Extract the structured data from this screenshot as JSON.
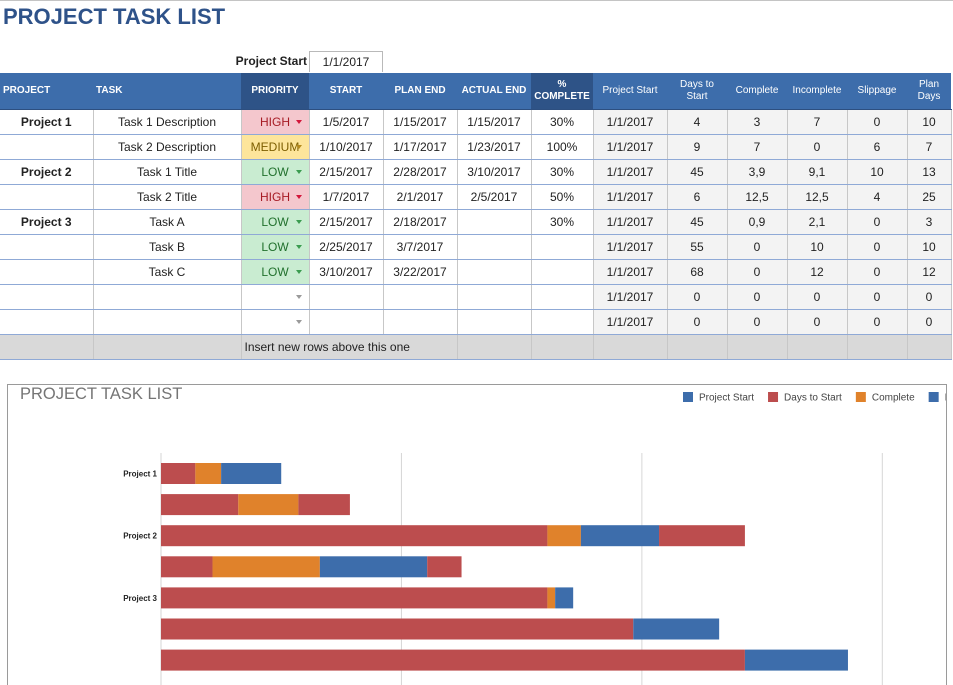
{
  "title": "PROJECT TASK LIST",
  "project_start": {
    "label": "Project Start",
    "value": "1/1/2017"
  },
  "table": {
    "headers": [
      "PROJECT",
      "TASK",
      "PRIORITY",
      "START",
      "PLAN END",
      "ACTUAL END",
      "% COMPLETE",
      "Project Start",
      "Days to Start",
      "Complete",
      "Incomplete",
      "Slippage",
      "Plan Days"
    ],
    "rows": [
      {
        "project": "Project 1",
        "task": "Task 1 Description",
        "priority": "HIGH",
        "start": "1/5/2017",
        "plan_end": "1/15/2017",
        "actual_end": "1/15/2017",
        "percent_complete": "30%",
        "project_start": "1/1/2017",
        "days_to_start": "4",
        "complete": "3",
        "incomplete": "7",
        "slippage": "0",
        "plan_days": "10"
      },
      {
        "project": "",
        "task": "Task 2 Description",
        "priority": "MEDIUM",
        "start": "1/10/2017",
        "plan_end": "1/17/2017",
        "actual_end": "1/23/2017",
        "percent_complete": "100%",
        "project_start": "1/1/2017",
        "days_to_start": "9",
        "complete": "7",
        "incomplete": "0",
        "slippage": "6",
        "plan_days": "7"
      },
      {
        "project": "Project 2",
        "task": "Task 1 Title",
        "priority": "LOW",
        "start": "2/15/2017",
        "plan_end": "2/28/2017",
        "actual_end": "3/10/2017",
        "percent_complete": "30%",
        "project_start": "1/1/2017",
        "days_to_start": "45",
        "complete": "3,9",
        "incomplete": "9,1",
        "slippage": "10",
        "plan_days": "13"
      },
      {
        "project": "",
        "task": "Task 2 Title",
        "priority": "HIGH",
        "start": "1/7/2017",
        "plan_end": "2/1/2017",
        "actual_end": "2/5/2017",
        "percent_complete": "50%",
        "project_start": "1/1/2017",
        "days_to_start": "6",
        "complete": "12,5",
        "incomplete": "12,5",
        "slippage": "4",
        "plan_days": "25"
      },
      {
        "project": "Project 3",
        "task": "Task A",
        "priority": "LOW",
        "start": "2/15/2017",
        "plan_end": "2/18/2017",
        "actual_end": "",
        "percent_complete": "30%",
        "project_start": "1/1/2017",
        "days_to_start": "45",
        "complete": "0,9",
        "incomplete": "2,1",
        "slippage": "0",
        "plan_days": "3"
      },
      {
        "project": "",
        "task": "Task B",
        "priority": "LOW",
        "start": "2/25/2017",
        "plan_end": "3/7/2017",
        "actual_end": "",
        "percent_complete": "",
        "project_start": "1/1/2017",
        "days_to_start": "55",
        "complete": "0",
        "incomplete": "10",
        "slippage": "0",
        "plan_days": "10"
      },
      {
        "project": "",
        "task": "Task C",
        "priority": "LOW",
        "start": "3/10/2017",
        "plan_end": "3/22/2017",
        "actual_end": "",
        "percent_complete": "",
        "project_start": "1/1/2017",
        "days_to_start": "68",
        "complete": "0",
        "incomplete": "12",
        "slippage": "0",
        "plan_days": "12"
      },
      {
        "project": "",
        "task": "",
        "priority": "",
        "start": "",
        "plan_end": "",
        "actual_end": "",
        "percent_complete": "",
        "project_start": "1/1/2017",
        "days_to_start": "0",
        "complete": "0",
        "incomplete": "0",
        "slippage": "0",
        "plan_days": "0"
      },
      {
        "project": "",
        "task": "",
        "priority": "",
        "start": "",
        "plan_end": "",
        "actual_end": "",
        "percent_complete": "",
        "project_start": "1/1/2017",
        "days_to_start": "0",
        "complete": "0",
        "incomplete": "0",
        "slippage": "0",
        "plan_days": "0"
      }
    ],
    "insert_row_text": "Insert new rows above this one"
  },
  "colors": {
    "header": "#3d6dab",
    "header_dark": "#2e5387",
    "title": "#2e5289",
    "priority": {
      "HIGH": {
        "bg": "#f4c7cd",
        "text": "#a61b24"
      },
      "MEDIUM": {
        "bg": "#fde59b",
        "text": "#7d5e00"
      },
      "LOW": {
        "bg": "#c9ecd1",
        "text": "#21702d"
      }
    }
  },
  "chart_data": {
    "type": "bar",
    "orientation": "horizontal",
    "stacked": true,
    "title": "PROJECT TASK LIST",
    "categories": [
      "Project 1",
      "",
      "Project 2",
      "",
      "Project 3",
      "",
      ""
    ],
    "baseline": "1/1/2017",
    "series": [
      {
        "name": "Project Start",
        "color": "#3d6dab",
        "visible": false,
        "values": [
          "1/1/2017",
          "1/1/2017",
          "1/1/2017",
          "1/1/2017",
          "1/1/2017",
          "1/1/2017",
          "1/1/2017"
        ]
      },
      {
        "name": "Days to Start",
        "color": "#bc4d4e",
        "visible": true,
        "values": [
          4,
          9,
          45,
          6,
          45,
          55,
          68
        ]
      },
      {
        "name": "Complete",
        "color": "#e0822b",
        "visible": true,
        "values": [
          3,
          7,
          3.9,
          12.5,
          0.9,
          0,
          0
        ]
      },
      {
        "name": "Incomplete",
        "color": "#3d6dab",
        "visible": true,
        "values": [
          7,
          0,
          9.1,
          12.5,
          2.1,
          10,
          12
        ]
      },
      {
        "name": "Slippage",
        "color": "#bc4d4e",
        "visible": true,
        "values": [
          0,
          6,
          10,
          4,
          0,
          0,
          0
        ]
      }
    ],
    "legend": [
      "Project Start",
      "Days to Start",
      "Complete",
      "Incomplete"
    ],
    "legend_position": "top-right",
    "xlabel": "",
    "ylabel": "",
    "xlim": [
      0,
      112
    ],
    "x_gridlines": [
      0,
      28,
      56,
      84,
      112
    ],
    "grid": true
  }
}
